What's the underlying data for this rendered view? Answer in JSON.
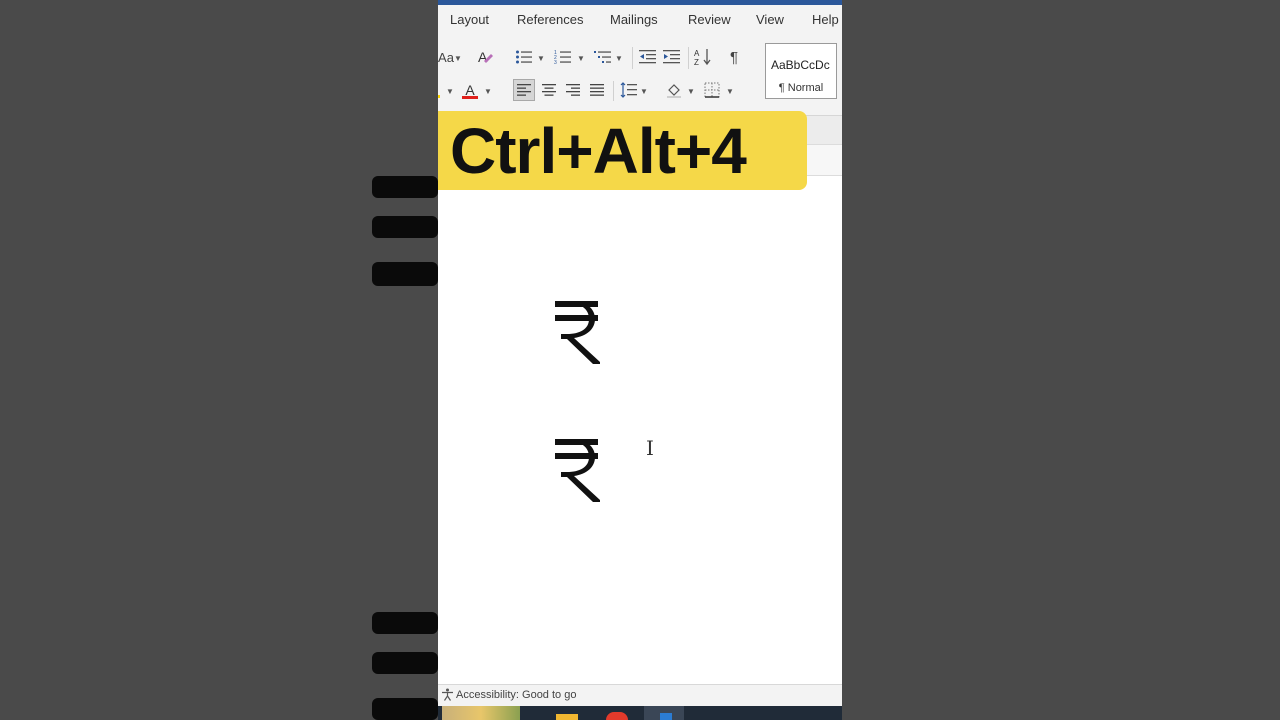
{
  "ribbon_tabs": [
    "Layout",
    "References",
    "Mailings",
    "Review",
    "View",
    "Help"
  ],
  "ribbon": {
    "font_size_glyph": "Aa",
    "font_color_glyph": "A",
    "font_color": "#e0201b",
    "pilcrow_glyph": "¶",
    "style_sample": "AaBbCcDc",
    "style_name": "¶ Normal"
  },
  "banner": {
    "text": "Ctrl+Alt+4",
    "color": "#f5d848"
  },
  "document": {
    "symbols": [
      "₹",
      "₹"
    ]
  },
  "status": {
    "accessibility": "Accessibility: Good to go"
  },
  "colors": {
    "word_blue": "#2b579a",
    "taskbar": "#202b38"
  }
}
